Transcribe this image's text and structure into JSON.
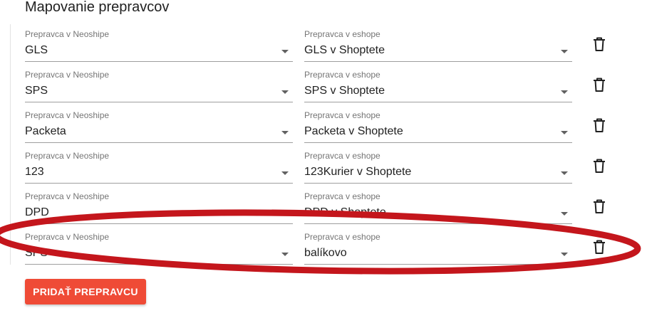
{
  "section": {
    "title": "Mapovanie prepravcov"
  },
  "rows": [
    {
      "carrier_label": "Prepravca v Neoshipe",
      "carrier_value": "GLS",
      "eshop_label": "Prepravca v eshope",
      "eshop_value": "GLS v Shoptete"
    },
    {
      "carrier_label": "Prepravca v Neoshipe",
      "carrier_value": "SPS",
      "eshop_label": "Prepravca v eshope",
      "eshop_value": "SPS v Shoptete"
    },
    {
      "carrier_label": "Prepravca v Neoshipe",
      "carrier_value": "Packeta",
      "eshop_label": "Prepravca v eshope",
      "eshop_value": "Packeta v Shoptete"
    },
    {
      "carrier_label": "Prepravca v Neoshipe",
      "carrier_value": "123",
      "eshop_label": "Prepravca v eshope",
      "eshop_value": "123Kurier v Shoptete"
    },
    {
      "carrier_label": "Prepravca v Neoshipe",
      "carrier_value": "DPD",
      "eshop_label": "Prepravca v eshope",
      "eshop_value": "DPD v Shoptete"
    },
    {
      "carrier_label": "Prepravca v Neoshipe",
      "carrier_value": "SPS",
      "eshop_label": "Prepravca v eshope",
      "eshop_value": "balíkovo"
    }
  ],
  "actions": {
    "add_label": "PRIDAŤ PREPRAVCU"
  },
  "colors": {
    "accent": "#ef4b36",
    "annotation": "#c4161c"
  },
  "icons": {
    "delete": "trash-icon",
    "dropdown": "chevron-down-icon"
  }
}
